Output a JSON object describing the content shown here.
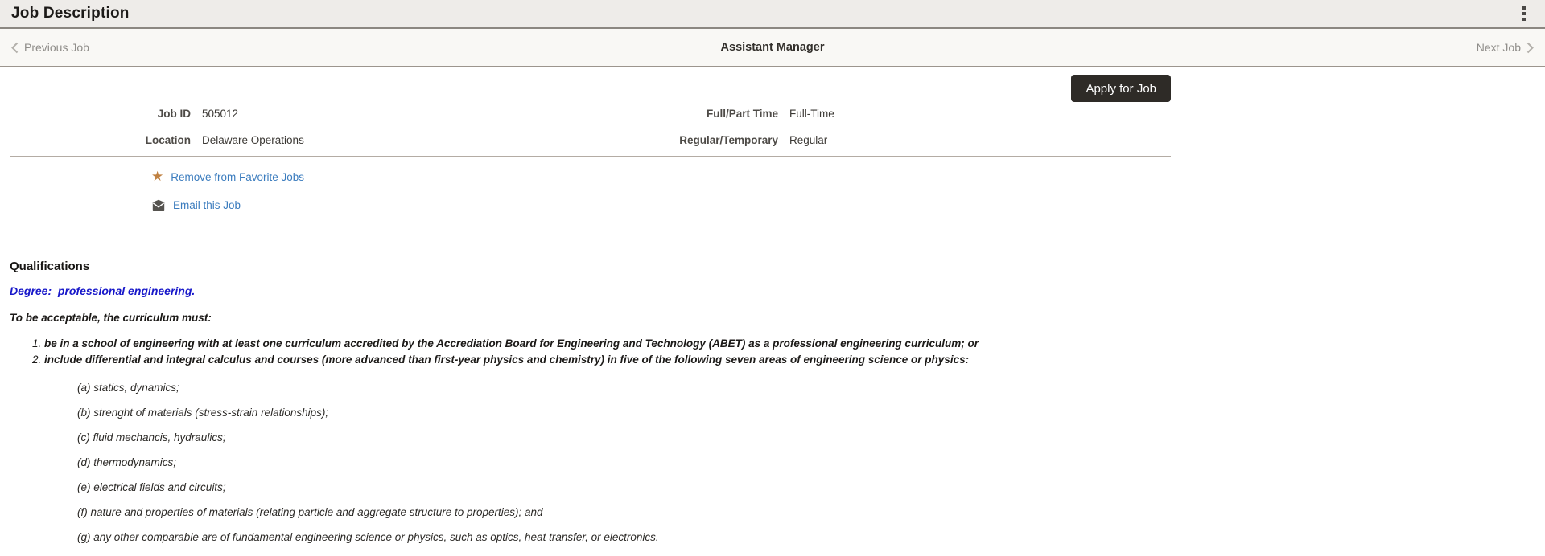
{
  "titlebar": {
    "title": "Job Description"
  },
  "nav": {
    "previous": "Previous Job",
    "current_job": "Assistant Manager",
    "next": "Next Job"
  },
  "actions": {
    "apply": "Apply for Job"
  },
  "details": {
    "fields": [
      {
        "label": "Job ID",
        "value": "505012"
      },
      {
        "label": "Location",
        "value": "Delaware Operations"
      },
      {
        "label": "Full/Part Time",
        "value": "Full-Time"
      },
      {
        "label": "Regular/Temporary",
        "value": "Regular"
      }
    ]
  },
  "links": {
    "favorite": "Remove from Favorite Jobs",
    "email": "Email this Job"
  },
  "qualifications": {
    "heading": "Qualifications",
    "degree_link": "Degree:  professional engineering. ",
    "intro": "To be acceptable, the curriculum must:",
    "numbered_items": [
      "be in a school of engineering with at least one curriculum accredited by the Accrediation Board for Engineering and Technology (ABET) as a professional engineering curriculum; or",
      "include differential and integral calculus and courses (more advanced than first-year physics and chemistry) in five of the following seven areas of engineering science or physics:"
    ],
    "lettered_items": [
      "(a) statics, dynamics;",
      "(b) strenght of materials (stress-strain relationships);",
      "(c) fluid mechancis, hydraulics;",
      "(d) thermodynamics;",
      "(e) electrical fields and circuits;",
      "(f) nature and properties of materials (relating particle and aggregate structure to properties); and",
      "(g) any other comparable are of fundamental engineering science or physics, such as optics, heat transfer, or electronics."
    ]
  },
  "colors": {
    "link_blue": "#3b7cbe",
    "degree_blue": "#1717c9",
    "star_orange": "#c08142",
    "apply_button_bg": "#2e2b27",
    "titlebar_bg": "#eeece9",
    "navbar_bg": "#f9f8f5"
  }
}
